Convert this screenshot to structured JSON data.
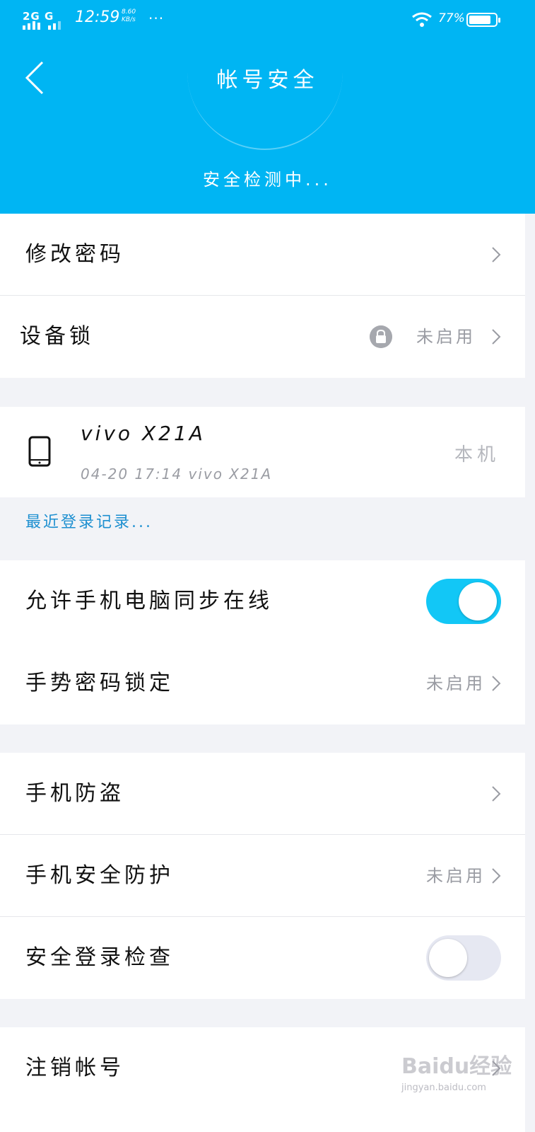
{
  "status_bar": {
    "network": "2G G",
    "time": "12:59",
    "speed_value": "8.60",
    "speed_unit": "KB/s",
    "more": "···",
    "battery": "77%"
  },
  "header": {
    "title": "帐号安全",
    "scanning": "安全检测中..."
  },
  "section1": {
    "change_password": "修改密码",
    "device_lock": "设备锁",
    "device_lock_status": "未启用"
  },
  "device": {
    "name": "vivo X21A",
    "login_time": "04-20 17:14 vivo X21A",
    "this_device": "本机"
  },
  "recent_logins": "最近登录记录...",
  "section2": {
    "sync_online": "允许手机电脑同步在线",
    "sync_online_on": true,
    "gesture_lock": "手势密码锁定",
    "gesture_lock_status": "未启用"
  },
  "section3": {
    "anti_theft": "手机防盗",
    "security_protection": "手机安全防护",
    "security_protection_status": "未启用",
    "login_check": "安全登录检查",
    "login_check_on": false
  },
  "section4": {
    "cancel_account": "注销帐号"
  },
  "watermark": {
    "logo": "Baidu经验",
    "url": "jingyan.baidu.com"
  },
  "colors": {
    "header_bg": "#00b5f3",
    "toggle_on": "#12c7f6",
    "link": "#1d8fd0"
  }
}
